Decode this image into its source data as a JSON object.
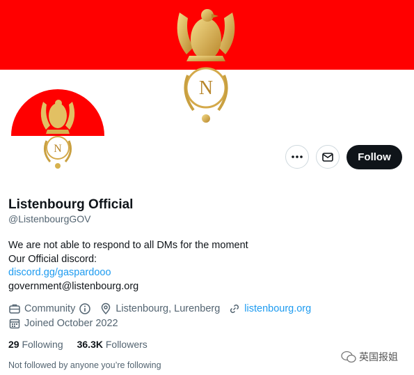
{
  "banner": {
    "color": "#ff0000",
    "emblem_letter": "N"
  },
  "avatar": {
    "emblem_letter": "N"
  },
  "actions": {
    "more_icon": "more-dots-icon",
    "message_icon": "envelope-icon",
    "follow_label": "Follow"
  },
  "profile": {
    "display_name": "Listenbourg Official",
    "handle": "@ListenbourgGOV",
    "bio": [
      "We are not able to respond to all DMs for the moment",
      "Our Official discord:",
      "discord.gg/gaspardooo",
      "government@listenbourg.org"
    ],
    "category": "Community",
    "location": "Listenbourg, Lurenberg",
    "website": "listenbourg.org",
    "joined": "Joined October 2022"
  },
  "stats": {
    "following_count": "29",
    "following_label": "Following",
    "followers_count": "36.3K",
    "followers_label": "Followers"
  },
  "followed_note": "Not followed by anyone you’re following",
  "watermark": "英国报姐",
  "colors": {
    "accent": "#1d9bf0",
    "secondary": "#536471",
    "text": "#0f1419"
  }
}
